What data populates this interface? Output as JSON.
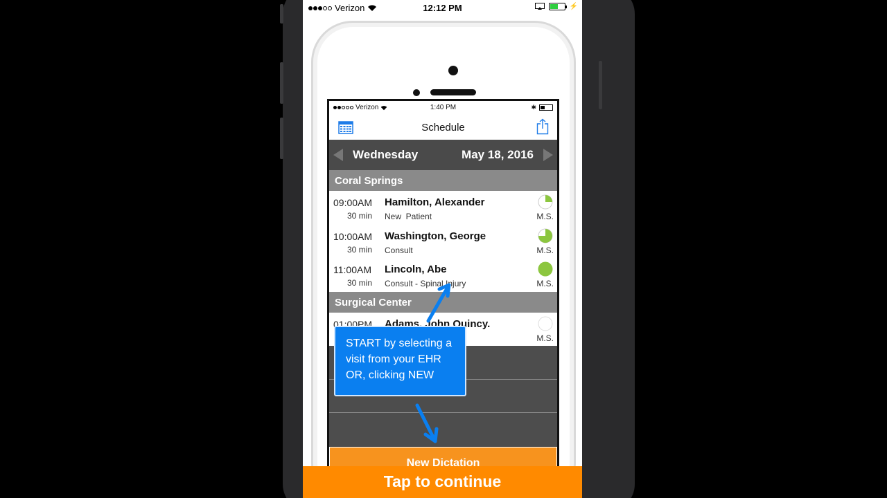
{
  "outer_status": {
    "carrier": "Verizon",
    "time": "12:12 PM"
  },
  "app": {
    "status": {
      "carrier": "Verizon",
      "time": "1:40 PM"
    },
    "nav_title": "Schedule",
    "date_bar": {
      "day": "Wednesday",
      "date": "May 18, 2016"
    },
    "sections": [
      {
        "name": "Coral Springs",
        "appointments": [
          {
            "time": "09:00AM",
            "duration": "30 min",
            "patient": "Hamilton, Alexander",
            "type": "New  Patient",
            "provider": "M.S.",
            "progress": 0.25
          },
          {
            "time": "10:00AM",
            "duration": "30 min",
            "patient": "Washington, George",
            "type": "Consult",
            "provider": "M.S.",
            "progress": 0.75
          },
          {
            "time": "11:00AM",
            "duration": "30 min",
            "patient": "Lincoln, Abe",
            "type": "Consult - Spinal Injury",
            "provider": "M.S.",
            "progress": 1.0
          }
        ]
      },
      {
        "name": "Surgical Center",
        "appointments": [
          {
            "time": "01:00PM",
            "duration": "",
            "patient": "Adams, John Quincy.",
            "type": "",
            "provider": "M.S.",
            "progress": 0
          }
        ]
      }
    ],
    "new_dictation_label": "New Dictation"
  },
  "callout_text": "START  by selecting a visit from your EHR OR, clicking NEW",
  "continue_label": "Tap to continue",
  "colors": {
    "accent_orange": "#ff8a00",
    "callout_blue": "#0a7ff0",
    "progress_green": "#8cc63f"
  },
  "icons": {
    "calendar": "calendar-icon",
    "share": "share-icon"
  }
}
